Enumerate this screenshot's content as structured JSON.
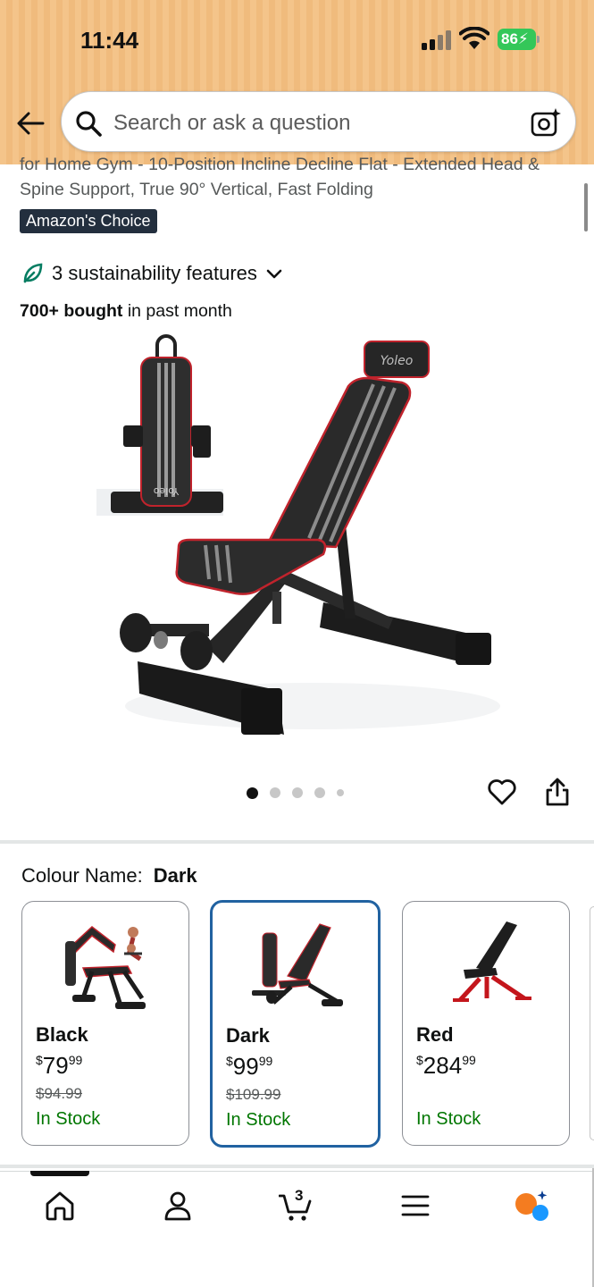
{
  "status_bar": {
    "time": "11:44",
    "battery": "86"
  },
  "search": {
    "placeholder": "Search or ask a question"
  },
  "product": {
    "title": "for Home Gym - 10-Position Incline Decline Flat - Extended Head & Spine Support, True 90° Vertical, Fast Folding",
    "badge": "Amazon's Choice",
    "sustainability": "3 sustainability features",
    "bought_bold": "700+ bought",
    "bought_rest": " in past month",
    "image_brand_text": "Yoleo",
    "image_count": 5,
    "active_image_index": 0
  },
  "variations": {
    "label": "Colour Name:",
    "selected": "Dark",
    "options": [
      {
        "name": "Black",
        "price_symbol": "$",
        "price_whole": "79",
        "price_fraction": "99",
        "was_price": "$94.99",
        "stock": "In Stock",
        "selected": false
      },
      {
        "name": "Dark",
        "price_symbol": "$",
        "price_whole": "99",
        "price_fraction": "99",
        "was_price": "$109.99",
        "stock": "In Stock",
        "selected": true
      },
      {
        "name": "Red",
        "price_symbol": "$",
        "price_whole": "284",
        "price_fraction": "99",
        "was_price": "",
        "stock": "In Stock",
        "selected": false
      }
    ]
  },
  "nav": {
    "items": [
      "home-icon",
      "account-icon",
      "cart-icon",
      "menu-icon",
      "rufus-icon"
    ],
    "cart_count": "3",
    "active": "home"
  },
  "colors": {
    "header_bg": "#f4c48a",
    "badge_bg": "#232f3e",
    "in_stock": "#007600",
    "selected_border": "#2162a1",
    "battery": "#34c759",
    "rufus_orange": "#f47c20",
    "rufus_blue": "#1a98ff"
  }
}
